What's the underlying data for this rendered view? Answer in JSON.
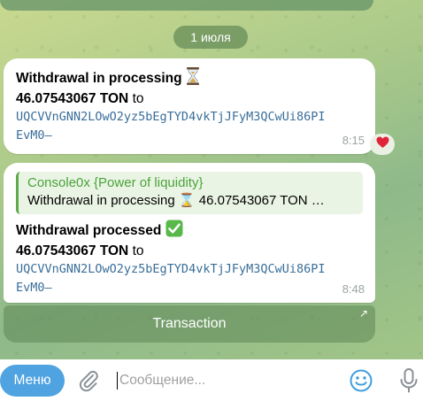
{
  "date_separator": "1 июля",
  "messages": [
    {
      "title": "Withdrawal in processing",
      "title_emoji": "hourglass-icon",
      "amount": "46.07543067 TON",
      "to_word": " to",
      "address_line1": "UQCVVnGNN2LOwO2yz5bEgTYD4vkTjJFyM3QCwUi86PI",
      "address_line2": "EvM0—",
      "time": "8:15",
      "reaction": "❤️"
    },
    {
      "quote_author": "Console0x {Power of liquidity}",
      "quote_text": "Withdrawal in processing ⌛ 46.07543067 TON …",
      "title": "Withdrawal processed",
      "title_emoji": "check-mark-icon",
      "amount": "46.07543067 TON",
      "to_word": " to",
      "address_line1": "UQCVVnGNN2LOwO2yz5bEgTYD4vkTjJFyM3QCwUi86PI",
      "address_line2": "EvM0—",
      "time": "8:48"
    }
  ],
  "inline_button": {
    "label": "Transaction",
    "arrow": "↗"
  },
  "input_bar": {
    "menu_label": "Меню",
    "placeholder": "Сообщение..."
  },
  "colors": {
    "accent": "#4fa3e0",
    "link": "#3a6e99",
    "quote_author": "#4aa33a"
  }
}
